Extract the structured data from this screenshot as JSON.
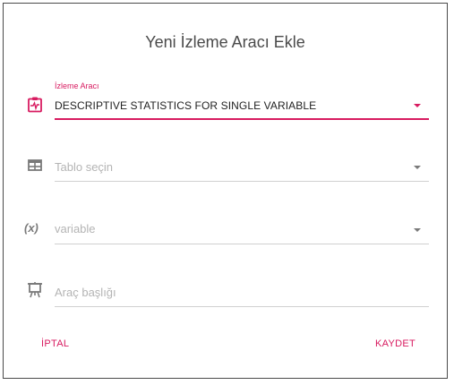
{
  "dialog": {
    "title": "Yeni İzleme Aracı Ekle"
  },
  "fields": {
    "tool": {
      "label": "İzleme Aracı",
      "value": "DESCRIPTIVE STATISTICS FOR SINGLE VARIABLE",
      "icon": "clipboard-pulse-icon"
    },
    "table": {
      "placeholder": "Tablo seçin",
      "icon": "table-icon"
    },
    "variable": {
      "icon_text": "(x)",
      "placeholder": "variable",
      "icon": "variable-icon"
    },
    "tool_title": {
      "placeholder": "Araç başlığı",
      "icon": "presentation-icon"
    }
  },
  "actions": {
    "cancel_label": "İPTAL",
    "save_label": "KAYDET"
  },
  "colors": {
    "accent": "#d81b60",
    "icon_gray": "#7a7a7a",
    "placeholder_gray": "#b4b4b4"
  }
}
